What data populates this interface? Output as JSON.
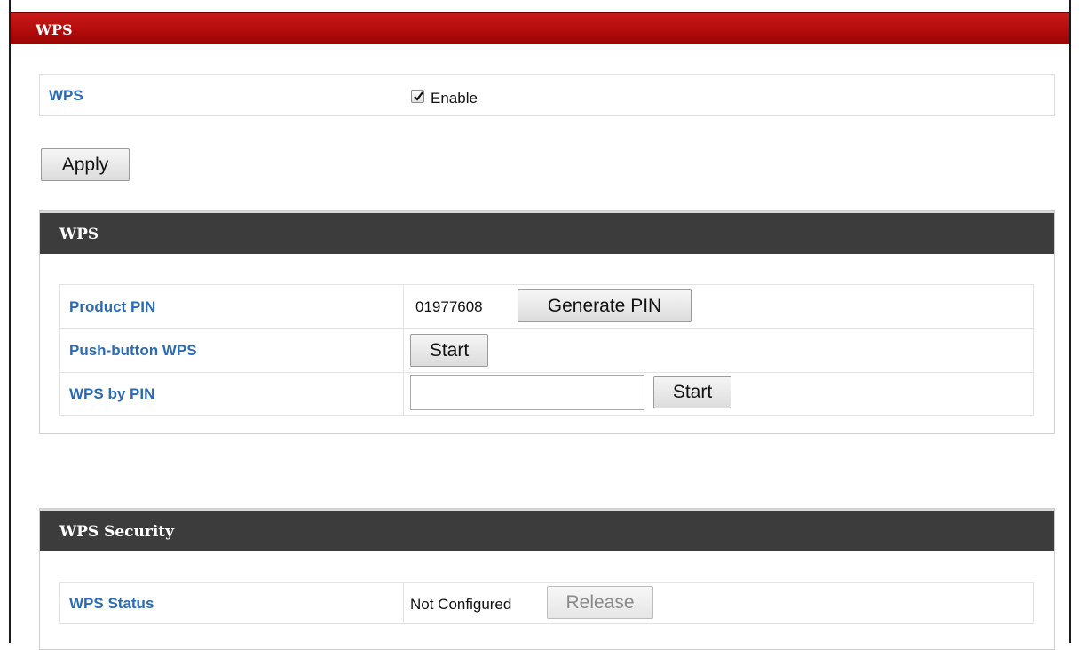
{
  "banner": {
    "title": "WPS"
  },
  "wps_enable": {
    "label": "WPS",
    "checkbox_label": "Enable",
    "checked": true
  },
  "apply_label": "Apply",
  "wps_panel": {
    "title": "WPS",
    "product_pin": {
      "label": "Product PIN",
      "value": "01977608",
      "button": "Generate PIN"
    },
    "push_button": {
      "label": "Push-button WPS",
      "button": "Start"
    },
    "by_pin": {
      "label": "WPS by PIN",
      "input_value": "",
      "button": "Start"
    }
  },
  "security_panel": {
    "title": "WPS Security",
    "status": {
      "label": "WPS Status",
      "value": "Not Configured",
      "button": "Release"
    }
  }
}
